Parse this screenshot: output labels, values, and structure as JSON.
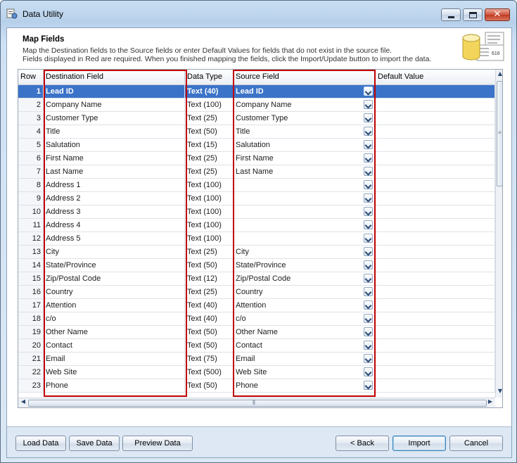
{
  "window": {
    "title": "Data Utility"
  },
  "header": {
    "title": "Map Fields",
    "line1": "Map the Destination fields to the Source fields or enter Default Values for fields that do not exist in the source file.",
    "line2": "Fields displayed in Red are required.  When you finished mapping the fields, click the Import/Update button to import the data.",
    "icon_number": "616"
  },
  "grid": {
    "columns": [
      "Row",
      "Destination Field",
      "Data Type",
      "Source Field",
      "Default Value"
    ],
    "rows": [
      {
        "row": "1",
        "dest": "Lead ID",
        "type": "Text (40)",
        "source": "Lead ID",
        "selected": true
      },
      {
        "row": "2",
        "dest": "Company Name",
        "type": "Text (100)",
        "source": "Company Name"
      },
      {
        "row": "3",
        "dest": "Customer Type",
        "type": "Text (25)",
        "source": "Customer Type"
      },
      {
        "row": "4",
        "dest": "Title",
        "type": "Text (50)",
        "source": "Title"
      },
      {
        "row": "5",
        "dest": "Salutation",
        "type": "Text (15)",
        "source": "Salutation"
      },
      {
        "row": "6",
        "dest": "First Name",
        "type": "Text (25)",
        "source": "First Name"
      },
      {
        "row": "7",
        "dest": "Last Name",
        "type": "Text (25)",
        "source": "Last Name"
      },
      {
        "row": "8",
        "dest": "Address 1",
        "type": "Text (100)",
        "source": ""
      },
      {
        "row": "9",
        "dest": "Address 2",
        "type": "Text (100)",
        "source": ""
      },
      {
        "row": "10",
        "dest": "Address 3",
        "type": "Text (100)",
        "source": ""
      },
      {
        "row": "11",
        "dest": "Address 4",
        "type": "Text (100)",
        "source": ""
      },
      {
        "row": "12",
        "dest": "Address 5",
        "type": "Text (100)",
        "source": ""
      },
      {
        "row": "13",
        "dest": "City",
        "type": "Text (25)",
        "source": "City"
      },
      {
        "row": "14",
        "dest": "State/Province",
        "type": "Text (50)",
        "source": "State/Province"
      },
      {
        "row": "15",
        "dest": "Zip/Postal Code",
        "type": "Text (12)",
        "source": "Zip/Postal Code"
      },
      {
        "row": "16",
        "dest": "Country",
        "type": "Text (25)",
        "source": "Country"
      },
      {
        "row": "17",
        "dest": "Attention",
        "type": "Text (40)",
        "source": "Attention"
      },
      {
        "row": "18",
        "dest": "c/o",
        "type": "Text (40)",
        "source": "c/o"
      },
      {
        "row": "19",
        "dest": "Other Name",
        "type": "Text (50)",
        "source": "Other Name"
      },
      {
        "row": "20",
        "dest": "Contact",
        "type": "Text (50)",
        "source": "Contact"
      },
      {
        "row": "21",
        "dest": "Email",
        "type": "Text (75)",
        "source": "Email"
      },
      {
        "row": "22",
        "dest": "Web Site",
        "type": "Text (500)",
        "source": "Web Site"
      },
      {
        "row": "23",
        "dest": "Phone",
        "type": "Text (50)",
        "source": "Phone"
      }
    ]
  },
  "footer": {
    "load": "Load Data",
    "save": "Save Data",
    "preview": "Preview Data",
    "back": "< Back",
    "import": "Import",
    "cancel": "Cancel"
  },
  "colors": {
    "selection": "#3a73c8",
    "highlight_box": "#c00000"
  }
}
